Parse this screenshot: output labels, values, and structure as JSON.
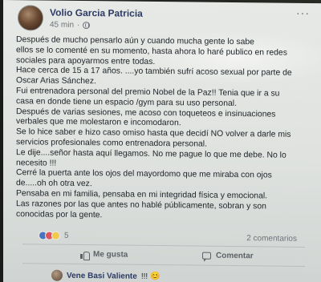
{
  "post": {
    "author": "Volio Garcia Patricia",
    "time": "45 min",
    "visibility_icon": "globe-icon",
    "more_label": "···",
    "lines": [
      "Después de mucho pensarlo aún y cuando mucha gente lo sabe",
      "ellos se lo comenté en su momento, hasta ahora lo haré publico en redes",
      "sociales para apoyarmos entre todas.",
      "Hace cerca de 15 a 17 años. ....yo también sufrí acoso sexual por parte de",
      "Oscar Arias Sánchez.",
      "Fui entrenadora personal del premio Nobel de la Paz!! Tenia que ir a su",
      "casa en donde tiene un espacio /gym para su uso personal.",
      "Después de varias sesiones, me acoso con toqueteos e insinuaciones",
      "verbales que me molestaron e incomodaron.",
      "Se lo hice saber e hizo caso omiso hasta que decidí NO volver a darle mis",
      "servicios profesionales como entrenadora personal.",
      "Le dije....señor hasta aquí llegamos. No me pague lo que me debe. No lo",
      "necesito !!!",
      "Cerré la puerta ante los ojos del mayordomo que me miraba con ojos",
      "de.....oh oh otra vez.",
      "Pensaba en mi familia, pensaba en mi integridad física y emocional.",
      "Las razones por las que antes no hablé públicamente, sobran y son",
      "conocidas por la gente."
    ]
  },
  "reactions": {
    "count": "5",
    "comments": "2 comentarios"
  },
  "actions": {
    "like_label": "Me gusta",
    "comment_label": "Comentar"
  },
  "comment_preview": {
    "author": "Vene Basi Valiente",
    "text": "!!! 😊"
  },
  "colors": {
    "author_name": "#2d3a63",
    "reaction_like": "#4a72c2",
    "reaction_love": "#e0515e",
    "reaction_wow": "#f2c94c"
  }
}
